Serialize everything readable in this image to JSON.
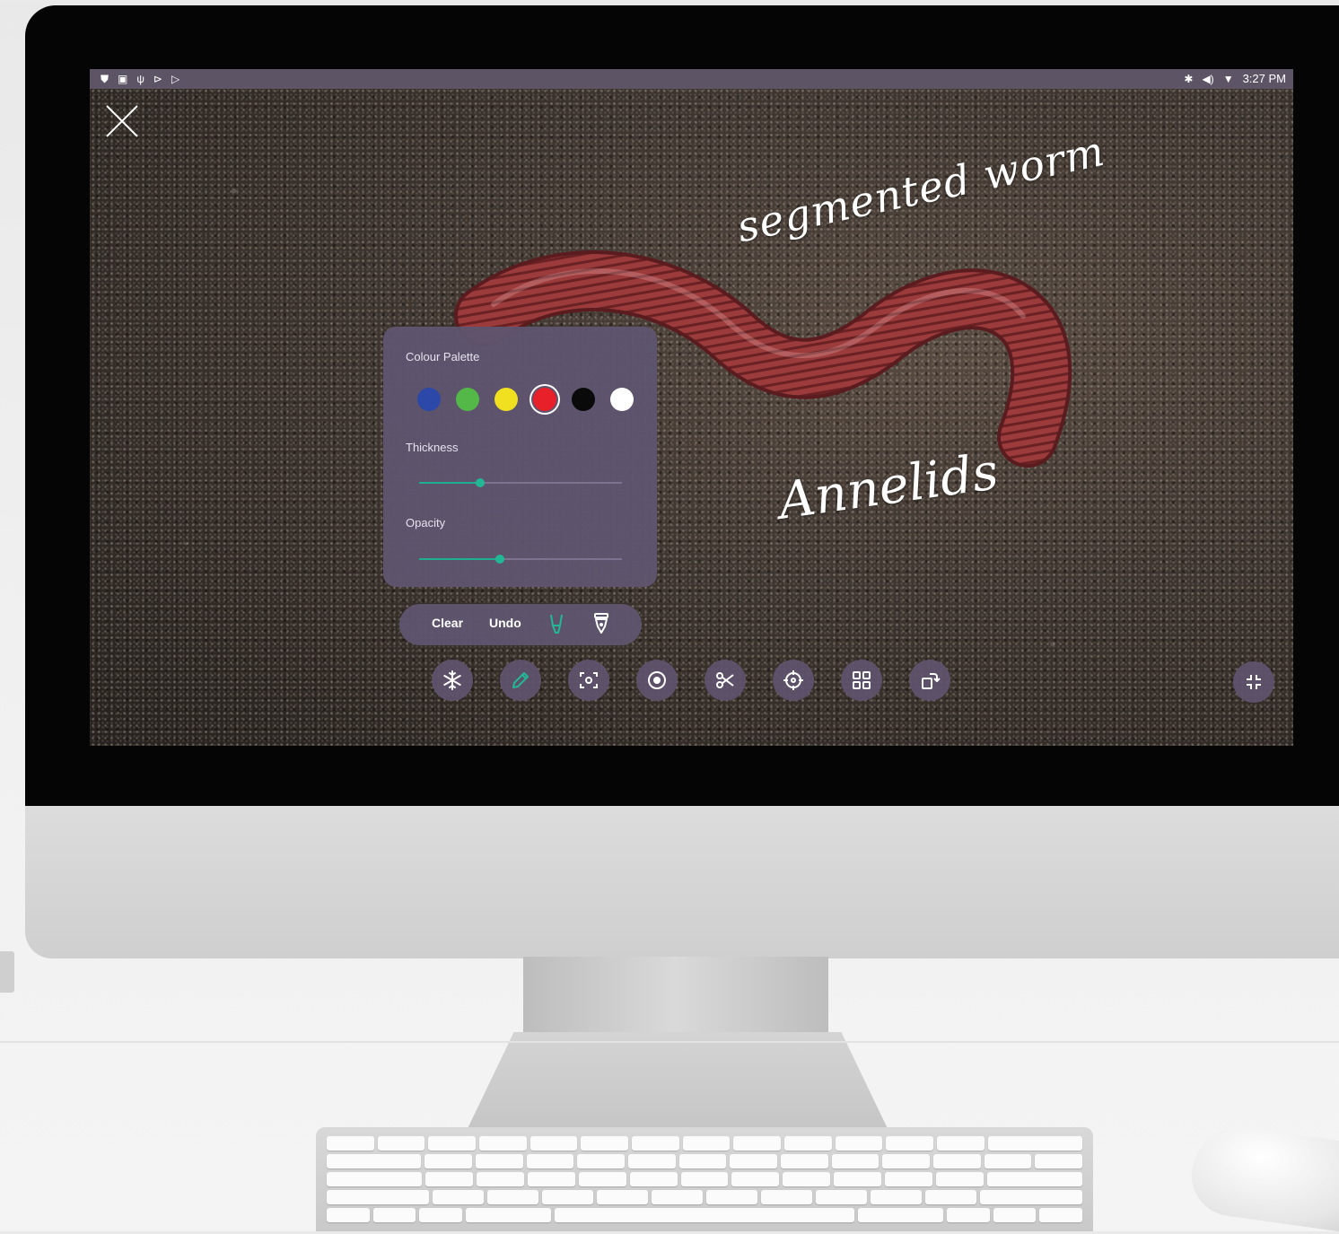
{
  "status_bar": {
    "left_icons": [
      "shield-icon",
      "image-icon",
      "usb-icon",
      "play-store-icon",
      "play-icon"
    ],
    "right_icons": [
      "bluetooth-icon",
      "volume-icon",
      "wifi-icon"
    ],
    "time": "3:27 PM"
  },
  "annotations": {
    "worm_note": "segmented worm",
    "annelids_note": "Annelids"
  },
  "palette_panel": {
    "colour_label": "Colour Palette",
    "colours": [
      {
        "name": "blue",
        "hex": "#2c48a8"
      },
      {
        "name": "green",
        "hex": "#54b848"
      },
      {
        "name": "yellow",
        "hex": "#f0e020"
      },
      {
        "name": "red",
        "hex": "#e8202a",
        "selected": true
      },
      {
        "name": "black",
        "hex": "#0a0a0a"
      },
      {
        "name": "white",
        "hex": "#ffffff"
      }
    ],
    "thickness_label": "Thickness",
    "thickness_value": 0.3,
    "opacity_label": "Opacity",
    "opacity_value": 0.4
  },
  "action_bar": {
    "clear_label": "Clear",
    "undo_label": "Undo",
    "icons": [
      "highlighter-icon",
      "pen-nib-icon"
    ]
  },
  "toolbar": {
    "tools": [
      "freeze-icon",
      "pen-icon",
      "screenshot-icon",
      "record-icon",
      "cut-icon",
      "spotlight-icon",
      "layout-icon",
      "rotate-icon"
    ],
    "exit_fullscreen": "exit-fullscreen-icon"
  },
  "colors": {
    "panel": "#5f546e",
    "accent": "#22b896",
    "status_bar": "#5d5466"
  }
}
